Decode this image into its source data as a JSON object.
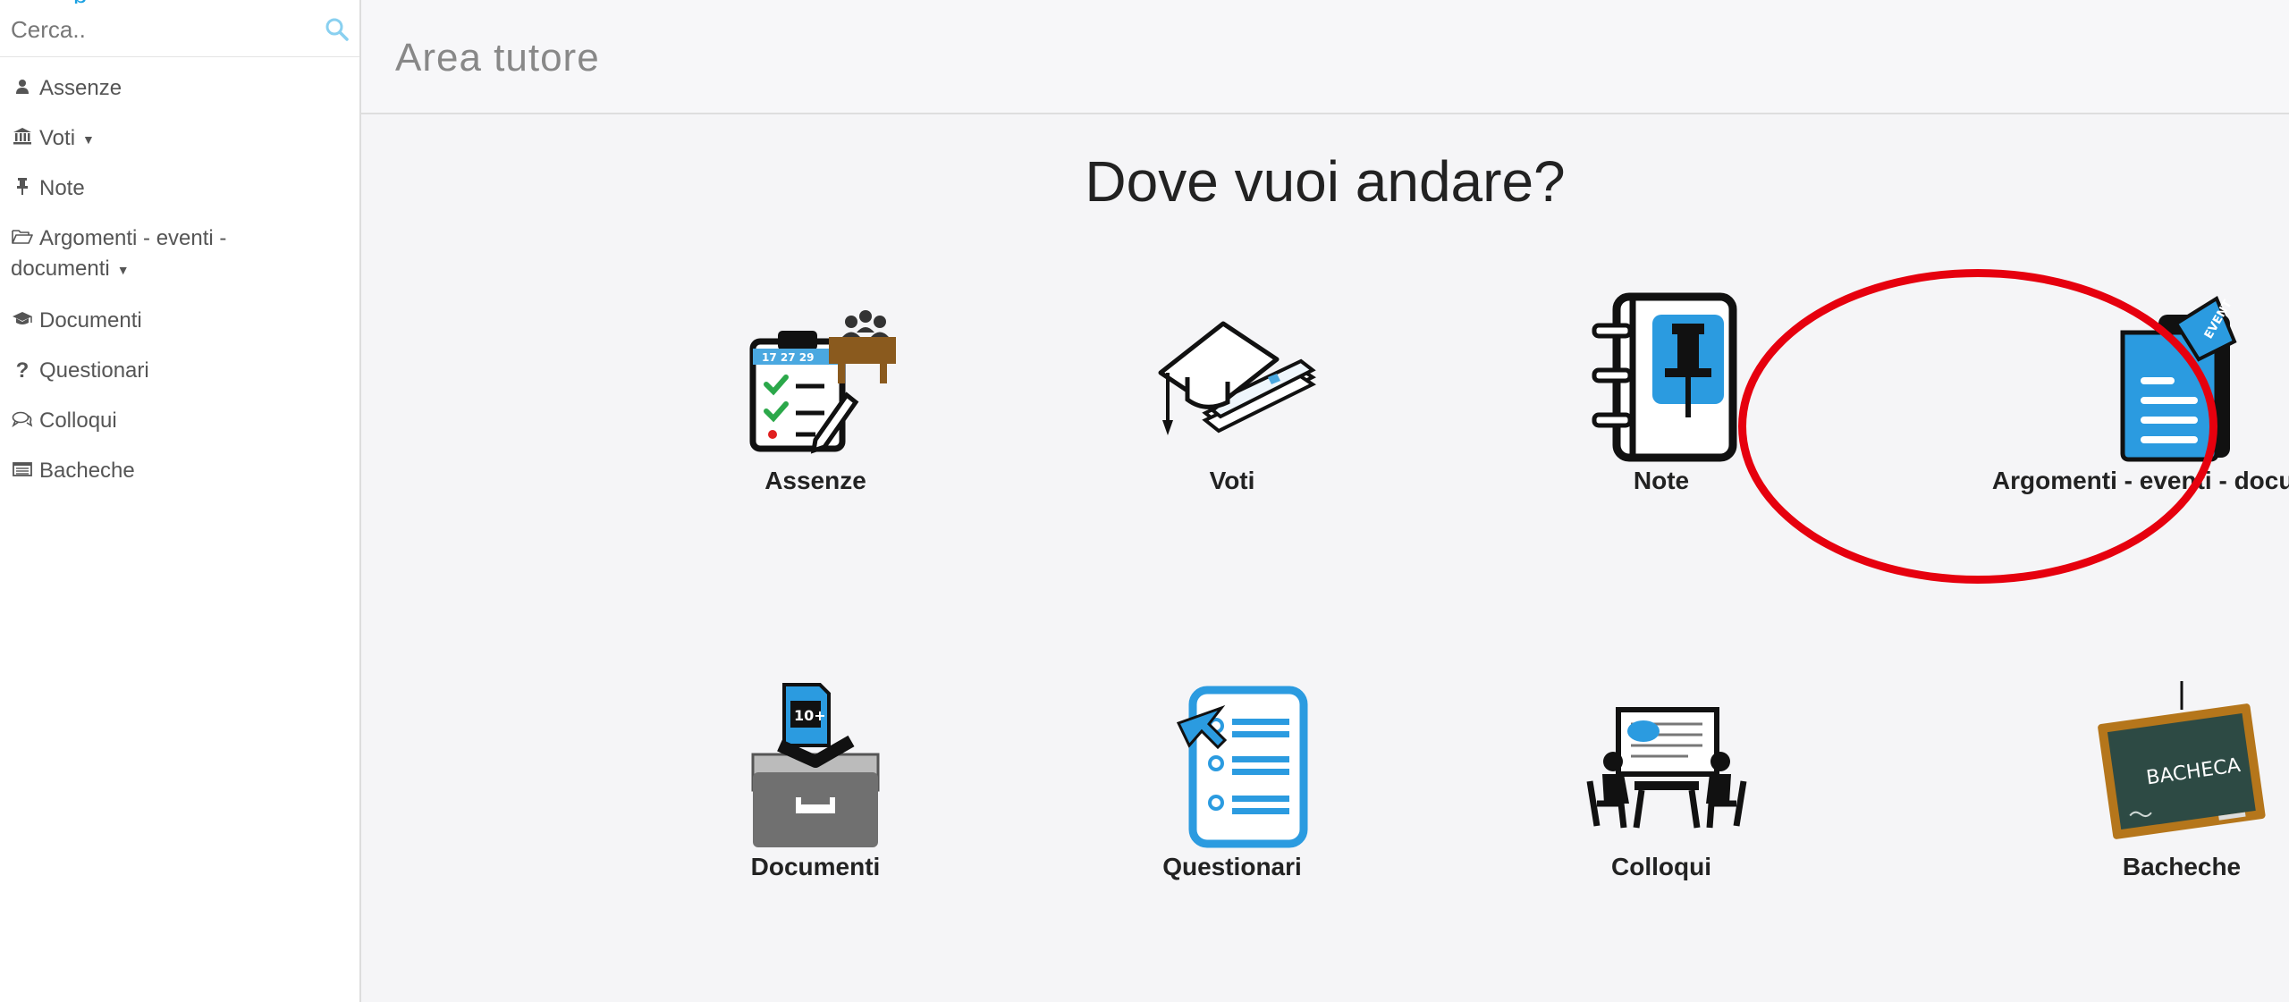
{
  "sidebar": {
    "search": {
      "placeholder": "Cerca.."
    },
    "items": [
      {
        "label": "Assenze",
        "icon": "user-icon"
      },
      {
        "label": "Voti",
        "icon": "bank-icon",
        "has_dropdown": true
      },
      {
        "label": "Note",
        "icon": "pin-icon"
      },
      {
        "label": "Argomenti - eventi - documenti",
        "line1": "Argomenti - eventi -",
        "line2": "documenti",
        "icon": "folder-open-icon",
        "has_dropdown": true
      },
      {
        "label": "Documenti",
        "icon": "graduation-cap-icon"
      },
      {
        "label": "Questionari",
        "icon": "question-icon"
      },
      {
        "label": "Colloqui",
        "icon": "comments-icon"
      },
      {
        "label": "Bacheche",
        "icon": "board-icon"
      }
    ]
  },
  "header": {
    "title": "Area tutore"
  },
  "main": {
    "heading": "Dove vuoi andare?",
    "tiles": [
      {
        "label": "Assenze",
        "icon": "attendance-clipboard-icon"
      },
      {
        "label": "Voti",
        "icon": "graduation-cap-papers-icon"
      },
      {
        "label": "Note",
        "icon": "notebook-pin-icon"
      },
      {
        "label": "Argomenti - eventi - documenti",
        "icon": "document-event-icon",
        "highlighted": true
      },
      {
        "label": "Documenti",
        "icon": "document-tray-icon"
      },
      {
        "label": "Questionari",
        "icon": "questionnaire-icon"
      },
      {
        "label": "Colloqui",
        "icon": "meeting-icon"
      },
      {
        "label": "Bacheche",
        "icon": "chalkboard-icon",
        "board_text": "BACHECA"
      }
    ]
  },
  "colors": {
    "accent": "#1ba1e2",
    "annotation": "#e6000e",
    "sidebar_text": "#555555",
    "header_title": "#888888"
  }
}
